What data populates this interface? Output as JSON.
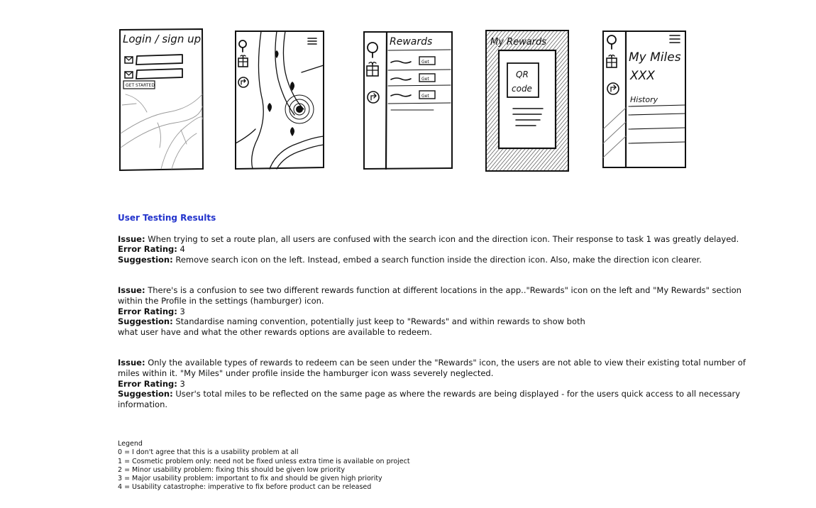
{
  "sketches": {
    "login": {
      "title": "Login / sign up",
      "button": "GET STARTED"
    },
    "rewards": {
      "title": "Rewards",
      "badges": [
        "Get",
        "Get",
        "Get"
      ]
    },
    "my_rewards": {
      "title": "My Rewards",
      "qr_line1": "QR",
      "qr_line2": "code"
    },
    "my_miles": {
      "title": "My Miles",
      "value": "XXX",
      "history": "History"
    }
  },
  "results": {
    "heading": "User Testing Results",
    "labels": {
      "issue": "Issue:",
      "error": "Error Rating:",
      "suggestion": "Suggestion:"
    },
    "issues": [
      {
        "issue": "When trying to set a route plan, all users are confused with the search icon and the direction icon. Their response to task 1 was greatly delayed.",
        "rating": "4",
        "suggestion": "Remove search icon on the left. Instead, embed a search function inside the direction icon. Also, make the direction icon clearer."
      },
      {
        "issue": "There's is a confusion to see two different rewards function at different locations in the app..\"Rewards\" icon on the left and \"My Rewards\" section within the Profile in the settings (hamburger) icon.",
        "rating": "3",
        "suggestion": "Standardise naming convention, potentially just keep to \"Rewards\" and within rewards to show both what user have and what the other rewards options are available to redeem."
      },
      {
        "issue": "Only the available types of rewards to redeem can be seen under the \"Rewards\" icon, the users are not able to view their existing total number of miles within it. \"My Miles\" under profile inside the hamburger icon wass severely neglected.",
        "rating": "3",
        "suggestion": "User's total miles to be reflected on the same page as where the rewards are being displayed - for the users quick access to all necessary information."
      }
    ]
  },
  "legend": {
    "title": "Legend",
    "items": [
      "0 = I don't agree that this is a usability problem at all",
      "1 = Cosmetic problem only: need not be fixed unless extra time is available on project",
      "2 = Minor usability problem: fixing this should be given low priority",
      "3 = Major usability problem: important to fix and should be given high priority",
      "4 = Usability catastrophe: imperative to fix before product can be released"
    ]
  }
}
